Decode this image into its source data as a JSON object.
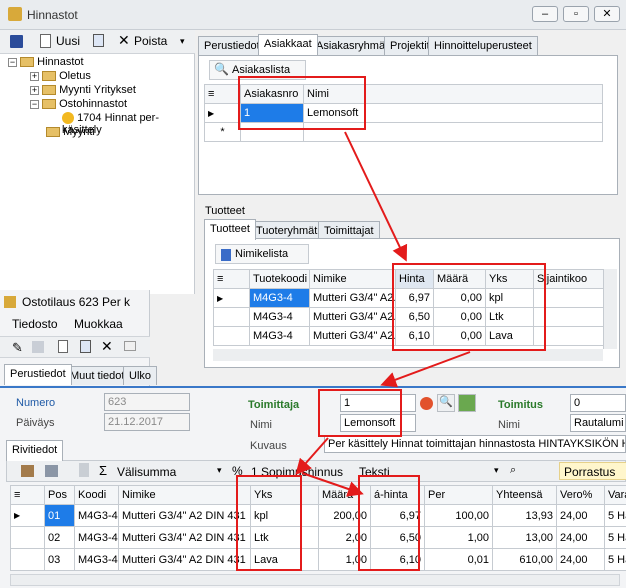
{
  "window": {
    "title": "Hinnastot"
  },
  "toolbar": {
    "new": "Uusi",
    "delete": "Poista"
  },
  "tree": {
    "root": "Hinnastot",
    "items": [
      "Oletus",
      "Myynti Yritykset",
      "Ostohinnastot",
      "1704 Hinnat per-käsittely",
      "Myynti"
    ]
  },
  "topTabs": [
    "Perustiedot",
    "Asiakkaat",
    "Asiakasryhmät",
    "Projektit",
    "Hinnoitteluperusteet"
  ],
  "customers": {
    "header": "Asiakaslista",
    "columns": [
      "Asiakasnro",
      "Nimi"
    ],
    "rows": [
      {
        "nro": "1",
        "nimi": "Lemonsoft"
      }
    ]
  },
  "products": {
    "section": "Tuotteet",
    "tabs": [
      "Tuotteet",
      "Tuoteryhmät",
      "Toimittajat"
    ],
    "header": "Nimikelista",
    "columns": [
      "Tuotekoodi",
      "Nimike",
      "Hinta",
      "Määrä",
      "Yks",
      "Sijaintikoo"
    ],
    "rows": [
      {
        "code": "M4G3-4",
        "name": "Mutteri G3/4\" A2...",
        "price": "6,97",
        "qty": "0,00",
        "unit": "kpl"
      },
      {
        "code": "M4G3-4",
        "name": "Mutteri G3/4\" A2...",
        "price": "6,50",
        "qty": "0,00",
        "unit": "Ltk"
      },
      {
        "code": "M4G3-4",
        "name": "Mutteri G3/4\" A2...",
        "price": "6,10",
        "qty": "0,00",
        "unit": "Lava"
      }
    ]
  },
  "order": {
    "title": "Ostotilaus 623 Per k",
    "menu": [
      "Tiedosto",
      "Muokkaa"
    ],
    "tabs": [
      "Perustiedot",
      "Muut tiedot",
      "Ulko"
    ],
    "numero_label": "Numero",
    "numero": "623",
    "paivays_label": "Päiväys",
    "paivays": "21.12.2017",
    "toimittaja_label": "Toimittaja",
    "toimittaja": "1",
    "nimi_label": "Nimi",
    "nimi": "Lemonsoft",
    "toimitus_label": "Toimitus",
    "toimitus": "0",
    "nimi2_label": "Nimi",
    "nimi2": "Rautalumi",
    "kuvaus_label": "Kuvaus",
    "kuvaus": "Per käsittely Hinnat toimittajan hinnastosta HINTAYKSIKÖN HINTA",
    "rows_tab": "Rivitiedot",
    "valisumma": "Välisumma",
    "pct": "%",
    "spopimus": "1 Sopimushinnus",
    "teksti": "Teksti",
    "porrastus": "Porrastus",
    "rowColumns": [
      "Pos",
      "Koodi",
      "Nimike",
      "Yks",
      "Määrä",
      "á-hinta",
      "Per",
      "Yhteensä",
      "Vero%",
      "Vara"
    ],
    "rows": [
      {
        "pos": "01",
        "code": "M4G3-4",
        "name": "Mutteri G3/4\" A2 DIN 431",
        "unit": "kpl",
        "qty": "200,00",
        "price": "6,97",
        "per": "100,00",
        "total": "13,93",
        "vat": "24,00",
        "vara": "5 Hä"
      },
      {
        "pos": "02",
        "code": "M4G3-4",
        "name": "Mutteri G3/4\" A2 DIN 431",
        "unit": "Ltk",
        "qty": "2,00",
        "price": "6,50",
        "per": "1,00",
        "total": "13,00",
        "vat": "24,00",
        "vara": "5 Hä"
      },
      {
        "pos": "03",
        "code": "M4G3-4",
        "name": "Mutteri G3/4\" A2 DIN 431",
        "unit": "Lava",
        "qty": "1,00",
        "price": "6,10",
        "per": "0,01",
        "total": "610,00",
        "vat": "24,00",
        "vara": "5 Hä"
      }
    ]
  }
}
